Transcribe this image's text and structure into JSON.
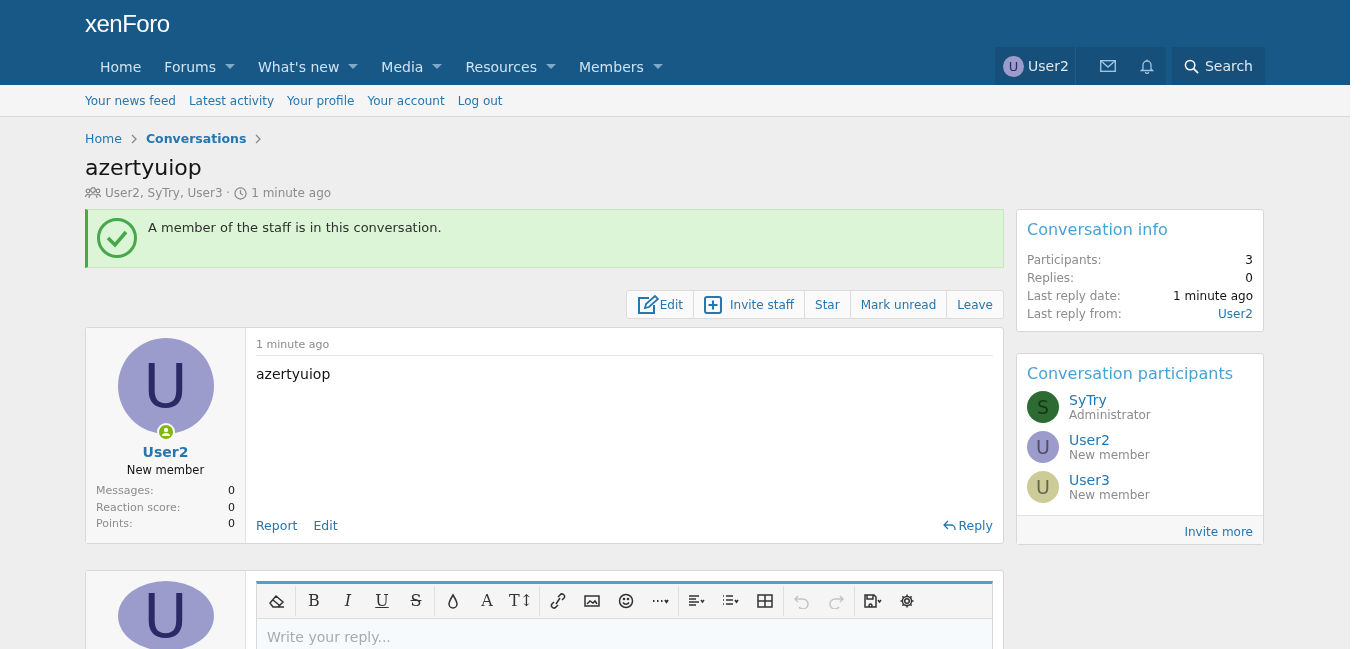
{
  "logo": "xenForo",
  "nav": [
    {
      "label": "Home",
      "dropdown": false,
      "selected": false
    },
    {
      "label": "Forums",
      "dropdown": true,
      "selected": false
    },
    {
      "label": "What's new",
      "dropdown": true,
      "selected": false
    },
    {
      "label": "Media",
      "dropdown": true,
      "selected": false
    },
    {
      "label": "Resources",
      "dropdown": true,
      "selected": false
    },
    {
      "label": "Members",
      "dropdown": true,
      "selected": false
    }
  ],
  "account": {
    "initial": "U",
    "name": "User2",
    "search": "Search"
  },
  "subnav": [
    "Your news feed",
    "Latest activity",
    "Your profile",
    "Your account",
    "Log out"
  ],
  "breadcrumbs": [
    {
      "label": "Home",
      "current": false
    },
    {
      "label": "Conversations",
      "current": true
    }
  ],
  "title": "azertyuiop",
  "meta": {
    "participants": "User2, SyTry, User3 ·",
    "time": "1 minute ago"
  },
  "notice": "A member of the staff is in this conversation.",
  "actions": [
    {
      "label": "Edit",
      "kind": "edit"
    },
    {
      "label": "Invite staff",
      "kind": "invite"
    },
    {
      "label": "Star",
      "kind": "plain"
    },
    {
      "label": "Mark unread",
      "kind": "plain"
    },
    {
      "label": "Leave",
      "kind": "plain"
    }
  ],
  "message": {
    "initial": "U",
    "color": "#9c9ccc",
    "online": true,
    "user": "User2",
    "role": "New member",
    "stats": [
      {
        "label": "Messages:",
        "value": "0"
      },
      {
        "label": "Reaction score:",
        "value": "0"
      },
      {
        "label": "Points:",
        "value": "0"
      }
    ],
    "time": "1 minute ago",
    "body": "azertyuiop",
    "links": [
      "Report",
      "Edit"
    ],
    "reply": "Reply"
  },
  "editor": {
    "initial": "U",
    "color": "#9c9ccc",
    "placeholder": "Write your reply...",
    "tools": [
      {
        "kind": "eraser",
        "disabled": false,
        "sep": true
      },
      {
        "kind": "bold",
        "label": "B",
        "disabled": false,
        "sep": false
      },
      {
        "kind": "italic",
        "label": "I",
        "disabled": false,
        "sep": false
      },
      {
        "kind": "underline",
        "label": "U",
        "disabled": false,
        "sep": false
      },
      {
        "kind": "strike",
        "label": "S",
        "disabled": false,
        "sep": true
      },
      {
        "kind": "drop",
        "disabled": false,
        "sep": false
      },
      {
        "kind": "font",
        "label": "A",
        "disabled": false,
        "sep": false
      },
      {
        "kind": "size",
        "label": "T↕",
        "disabled": false,
        "sep": true
      },
      {
        "kind": "link",
        "disabled": false,
        "sep": false
      },
      {
        "kind": "image",
        "disabled": false,
        "sep": false
      },
      {
        "kind": "smile",
        "disabled": false,
        "sep": false
      },
      {
        "kind": "more",
        "disabled": false,
        "sep": true
      },
      {
        "kind": "align",
        "disabled": false,
        "sep": false
      },
      {
        "kind": "list",
        "disabled": false,
        "sep": false
      },
      {
        "kind": "table",
        "disabled": false,
        "sep": true
      },
      {
        "kind": "undo",
        "disabled": true,
        "sep": false
      },
      {
        "kind": "redo",
        "disabled": true,
        "sep": true
      },
      {
        "kind": "save",
        "disabled": false,
        "sep": false
      },
      {
        "kind": "gear",
        "disabled": false,
        "sep": false
      }
    ]
  },
  "info": {
    "title": "Conversation info",
    "rows": [
      {
        "label": "Participants:",
        "value": "3",
        "link": false
      },
      {
        "label": "Replies:",
        "value": "0",
        "link": false
      },
      {
        "label": "Last reply date:",
        "value": "1 minute ago",
        "link": false
      },
      {
        "label": "Last reply from:",
        "value": "User2",
        "link": true
      }
    ]
  },
  "participants": {
    "title": "Conversation participants",
    "people": [
      {
        "initial": "S",
        "name": "SyTry",
        "role": "Administrator",
        "color": "#2e6b32"
      },
      {
        "initial": "U",
        "name": "User2",
        "role": "New member",
        "color": "#9c9ccc"
      },
      {
        "initial": "U",
        "name": "User3",
        "role": "New member",
        "color": "#cccc99"
      }
    ],
    "more": "Invite more"
  }
}
